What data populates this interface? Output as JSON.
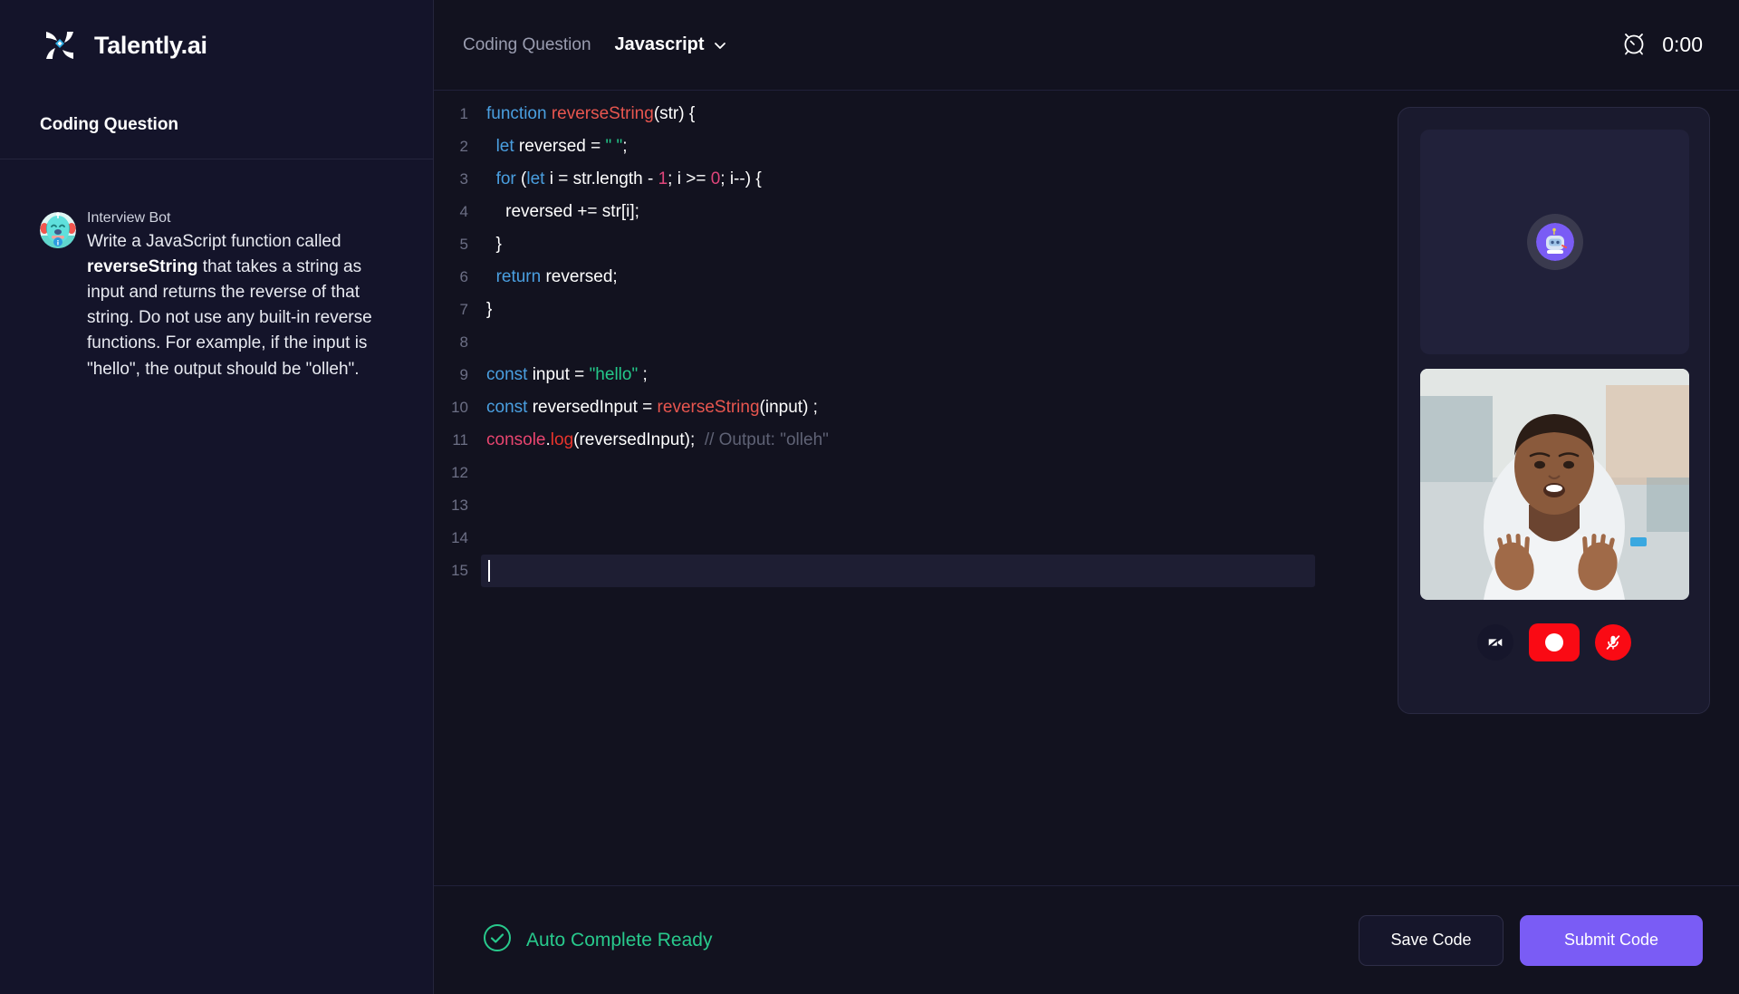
{
  "brand": {
    "name": "Talently.ai",
    "logo_icon": "talently-logo-icon"
  },
  "sidebar": {
    "title": "Coding Question",
    "bot": {
      "name": "Interview Bot",
      "avatar_icon": "interview-bot-avatar-icon",
      "question_part1": "Write a JavaScript function called ",
      "question_bold": "reverseString",
      "question_part2": " that takes a string as input and returns the reverse of that string. Do not use any built-in reverse functions. For example, if the input is \"hello\", the output should be \"olleh\"."
    }
  },
  "topbar": {
    "breadcrumb": "Coding Question",
    "language": "Javascript",
    "chevron_icon": "chevron-down-icon",
    "timer_icon": "alarm-clock-icon",
    "timer_value": "0:00"
  },
  "editor": {
    "lines": [
      {
        "n": "1",
        "tokens": [
          {
            "t": "function",
            "c": "kw"
          },
          {
            "t": " ",
            "c": ""
          },
          {
            "t": "reverseString",
            "c": "fn"
          },
          {
            "t": "(str) {",
            "c": ""
          }
        ]
      },
      {
        "n": "2",
        "tokens": [
          {
            "t": "  ",
            "c": ""
          },
          {
            "t": "let",
            "c": "kw"
          },
          {
            "t": " reversed = ",
            "c": ""
          },
          {
            "t": "\" \"",
            "c": "str"
          },
          {
            "t": ";",
            "c": ""
          }
        ]
      },
      {
        "n": "3",
        "tokens": [
          {
            "t": "  ",
            "c": ""
          },
          {
            "t": "for",
            "c": "kw"
          },
          {
            "t": " (",
            "c": ""
          },
          {
            "t": "let",
            "c": "kw"
          },
          {
            "t": " i = str.length - ",
            "c": ""
          },
          {
            "t": "1",
            "c": "num"
          },
          {
            "t": "; i >= ",
            "c": ""
          },
          {
            "t": "0",
            "c": "num"
          },
          {
            "t": "; i--) {",
            "c": ""
          }
        ]
      },
      {
        "n": "4",
        "tokens": [
          {
            "t": "    reversed += str[i];",
            "c": ""
          }
        ]
      },
      {
        "n": "5",
        "tokens": [
          {
            "t": "  }",
            "c": ""
          }
        ]
      },
      {
        "n": "6",
        "tokens": [
          {
            "t": "  ",
            "c": ""
          },
          {
            "t": "return",
            "c": "kw"
          },
          {
            "t": " reversed;",
            "c": ""
          }
        ]
      },
      {
        "n": "7",
        "tokens": [
          {
            "t": "}",
            "c": ""
          }
        ]
      },
      {
        "n": "8",
        "tokens": [
          {
            "t": "",
            "c": ""
          }
        ]
      },
      {
        "n": "9",
        "tokens": [
          {
            "t": "const",
            "c": "kw"
          },
          {
            "t": " input = ",
            "c": ""
          },
          {
            "t": "\"hello\"",
            "c": "str"
          },
          {
            "t": " ;",
            "c": ""
          }
        ]
      },
      {
        "n": "10",
        "tokens": [
          {
            "t": "const",
            "c": "kw"
          },
          {
            "t": " reversedInput = ",
            "c": ""
          },
          {
            "t": "reverseString",
            "c": "fn"
          },
          {
            "t": "(input) ;",
            "c": ""
          }
        ]
      },
      {
        "n": "11",
        "tokens": [
          {
            "t": "console",
            "c": "obj"
          },
          {
            "t": ".",
            "c": ""
          },
          {
            "t": "log",
            "c": "meth"
          },
          {
            "t": "(reversedInput);  ",
            "c": ""
          },
          {
            "t": "// Output: \"olleh\"",
            "c": "com"
          }
        ]
      },
      {
        "n": "12",
        "tokens": [
          {
            "t": "",
            "c": ""
          }
        ]
      },
      {
        "n": "13",
        "tokens": [
          {
            "t": "",
            "c": ""
          }
        ]
      },
      {
        "n": "14",
        "tokens": [
          {
            "t": "",
            "c": ""
          }
        ]
      },
      {
        "n": "15",
        "tokens": [
          {
            "t": "",
            "c": ""
          }
        ],
        "active": true,
        "caret": true
      }
    ]
  },
  "video_panel": {
    "ai_avatar_icon": "ai-robot-avatar-icon",
    "camera_feed_icon": "candidate-camera-feed",
    "controls": {
      "camera_icon": "camera-off-icon",
      "record_icon": "record-icon",
      "mic_icon": "microphone-muted-icon"
    }
  },
  "footer": {
    "status_icon": "check-circle-icon",
    "status_label": "Auto Complete Ready",
    "save_label": "Save Code",
    "submit_label": "Submit Code"
  },
  "colors": {
    "accent_purple": "#7a5cf5",
    "status_green": "#28c98c",
    "record_red": "#fa0a14",
    "logo_cyan": "#29a9e0"
  }
}
